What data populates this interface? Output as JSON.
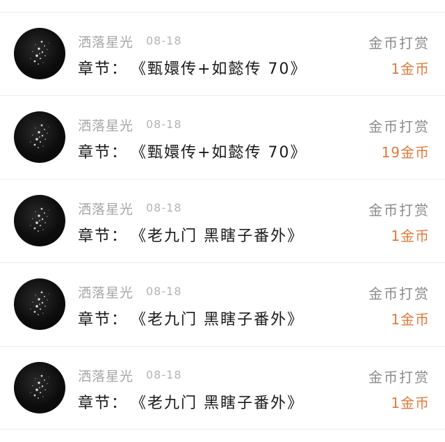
{
  "rows": [
    {
      "username": "洒落星光",
      "date": "08-18",
      "chapter_label": "章节：",
      "chapter_title": "《甄嬛传+如懿传 70》",
      "reward_type": "金币打赏",
      "reward_amount": "1金币"
    },
    {
      "username": "洒落星光",
      "date": "08-18",
      "chapter_label": "章节：",
      "chapter_title": "《甄嬛传+如懿传 70》",
      "reward_type": "金币打赏",
      "reward_amount": "19金币"
    },
    {
      "username": "洒落星光",
      "date": "08-18",
      "chapter_label": "章节：",
      "chapter_title": "《老九门 黑瞎子番外》",
      "reward_type": "金币打赏",
      "reward_amount": "1金币"
    },
    {
      "username": "洒落星光",
      "date": "08-18",
      "chapter_label": "章节：",
      "chapter_title": "《老九门 黑瞎子番外》",
      "reward_type": "金币打赏",
      "reward_amount": "1金币"
    },
    {
      "username": "洒落星光",
      "date": "08-18",
      "chapter_label": "章节：",
      "chapter_title": "《老九门 黑瞎子番外》",
      "reward_type": "金币打赏",
      "reward_amount": "1金币"
    }
  ],
  "colors": {
    "username": "#a6a6a6",
    "date": "#b4b4b4",
    "chapter_text": "#1a1a1a",
    "reward_type": "#8a8a8a",
    "reward_amount": "#e07a3a",
    "divider": "#ececec",
    "avatar_bg": "#0d0d0d"
  },
  "icons": {
    "avatar": "starry-night-avatar"
  }
}
